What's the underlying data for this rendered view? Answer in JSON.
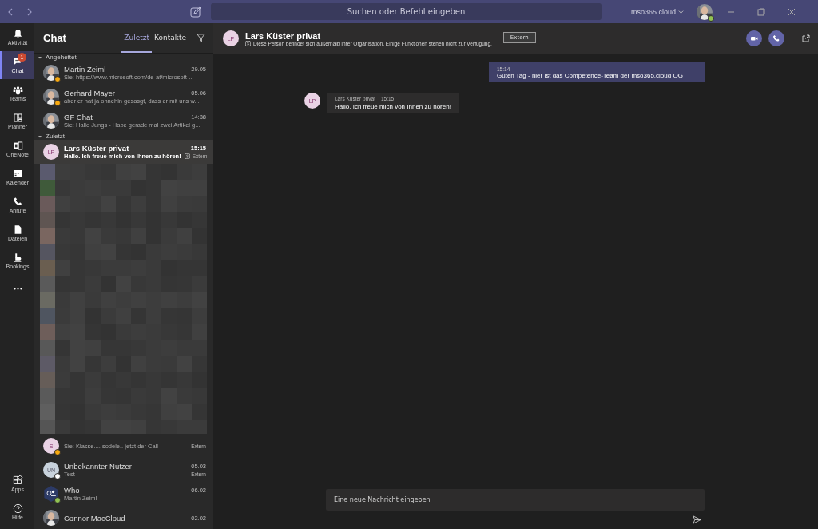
{
  "title_bar": {
    "search": {
      "placeholder": "Suchen oder Befehl eingeben"
    },
    "tenant": "mso365.cloud"
  },
  "rail": {
    "items": [
      {
        "kind": "bell",
        "label": "Aktivität",
        "selected": false
      },
      {
        "kind": "chat",
        "label": "Chat",
        "selected": true,
        "badge": "1"
      },
      {
        "kind": "teams",
        "label": "Teams",
        "selected": false
      },
      {
        "kind": "planner",
        "label": "Planner",
        "selected": false
      },
      {
        "kind": "onenote",
        "label": "OneNote",
        "selected": false
      },
      {
        "kind": "calendar",
        "label": "Kalender",
        "selected": false
      },
      {
        "kind": "phone",
        "label": "Anrufe",
        "selected": false
      },
      {
        "kind": "file",
        "label": "Dateien",
        "selected": false
      },
      {
        "kind": "bookings",
        "label": "Bookings",
        "selected": false
      },
      {
        "kind": "more",
        "selected": false
      }
    ],
    "bottom": [
      {
        "kind": "apps",
        "label": "Apps"
      },
      {
        "kind": "help",
        "label": "Hilfe"
      }
    ]
  },
  "chat_list": {
    "title": "Chat",
    "tabs": [
      {
        "label": "Zuletzt",
        "selected": true
      },
      {
        "label": "Kontakte",
        "selected": false
      }
    ],
    "sections": [
      {
        "title": "Angeheftet",
        "items": [
          {
            "color": "#f8a90f",
            "name": "Martin Zeiml",
            "time": "29.05",
            "preview": "Sie: https://www.microsoft.com/de-at/microsoft-...",
            "selected": false,
            "unread": false
          },
          {
            "color": "#f8a90f",
            "name": "Gerhard Mayer",
            "time": "05.06",
            "preview": "aber er hat ja ohnehin gesasgt, dass er mit uns w...",
            "selected": false,
            "unread": false
          },
          {
            "name": "GF Chat",
            "time": "14:38",
            "preview": "Sie: Hallo Jungs - Habe gerade mal zwei Artikel g...",
            "selected": false,
            "unread": false
          }
        ]
      },
      {
        "title": "Zuletzt",
        "items": [
          {
            "kind": "initials",
            "initials": "LP",
            "name": "Lars Küster privat",
            "time": "15:15",
            "preview": "Hallo. Ich freue mich von Ihnen zu hören!",
            "extern": "Extern",
            "selected": true,
            "unread": true
          },
          {
            "kind": "pixelated"
          },
          {
            "kind": "initials",
            "initials": "S",
            "color": "#f8a90f",
            "preview": "Sie: Klasse.... sodele.. jetzt der Call",
            "extern": "Extern",
            "selected": false,
            "unread": false
          },
          {
            "kind": "guest",
            "initials": "UN",
            "color": "#ffffff",
            "name": "Unbekannter Nutzer",
            "time": "05.03",
            "preview": "Test",
            "extern": "Extern",
            "selected": false,
            "unread": false
          },
          {
            "kind": "group",
            "color": "#92c353",
            "name": "Who",
            "time": "06.02",
            "preview": "Martin Zeiml",
            "selected": false,
            "unread": false
          },
          {
            "name": "Connor MacCloud",
            "time": "02.02",
            "selected": false,
            "unread": false
          }
        ]
      }
    ]
  },
  "conversation": {
    "initials": "LP",
    "name": "Lars Küster privat",
    "notice": "Diese Person befindet sich außerhalb Ihrer Organisation. Einige Funktionen stehen nicht zur Verfügung.",
    "badge": "Extern",
    "messages": [
      {
        "kind": "own",
        "time": "15:14",
        "text": "Guten Tag - hier ist das Competence-Team der mso365.cloud OG"
      },
      {
        "kind": "other",
        "initials": "LP",
        "author": "Lars Küster privat",
        "time": "15:15",
        "text": "Hallo. Ich freue mich von Ihnen zu hören!"
      }
    ],
    "compose": {
      "placeholder": "Eine neue Nachricht eingeben"
    }
  }
}
